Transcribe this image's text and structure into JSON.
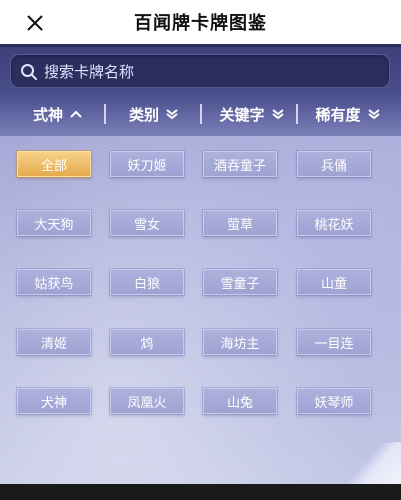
{
  "header": {
    "title": "百闻牌卡牌图鉴",
    "close_icon": "close-icon"
  },
  "search": {
    "placeholder": "搜索卡牌名称",
    "icon": "search-icon"
  },
  "filters": [
    {
      "label": "式神",
      "icon": "chevron-up-icon"
    },
    {
      "label": "类别",
      "icon": "double-chevron-down-icon"
    },
    {
      "label": "关键字",
      "icon": "double-chevron-down-icon"
    },
    {
      "label": "稀有度",
      "icon": "double-chevron-down-icon"
    }
  ],
  "cards": [
    {
      "label": "全部",
      "active": true
    },
    {
      "label": "妖刀姬",
      "active": false
    },
    {
      "label": "酒吞童子",
      "active": false
    },
    {
      "label": "兵俑",
      "active": false
    },
    {
      "label": "大天狗",
      "active": false
    },
    {
      "label": "雪女",
      "active": false
    },
    {
      "label": "萤草",
      "active": false
    },
    {
      "label": "桃花妖",
      "active": false
    },
    {
      "label": "姑获鸟",
      "active": false
    },
    {
      "label": "白狼",
      "active": false
    },
    {
      "label": "雪童子",
      "active": false
    },
    {
      "label": "山童",
      "active": false
    },
    {
      "label": "清姬",
      "active": false
    },
    {
      "label": "鸩",
      "active": false
    },
    {
      "label": "海坊主",
      "active": false
    },
    {
      "label": "一目连",
      "active": false
    },
    {
      "label": "犬神",
      "active": false
    },
    {
      "label": "凤凰火",
      "active": false
    },
    {
      "label": "山兔",
      "active": false
    },
    {
      "label": "妖琴师",
      "active": false
    }
  ],
  "colors": {
    "active_card": "#e4a94c",
    "panel": "#a8acd8",
    "search_bg": "#2c2e5e"
  }
}
